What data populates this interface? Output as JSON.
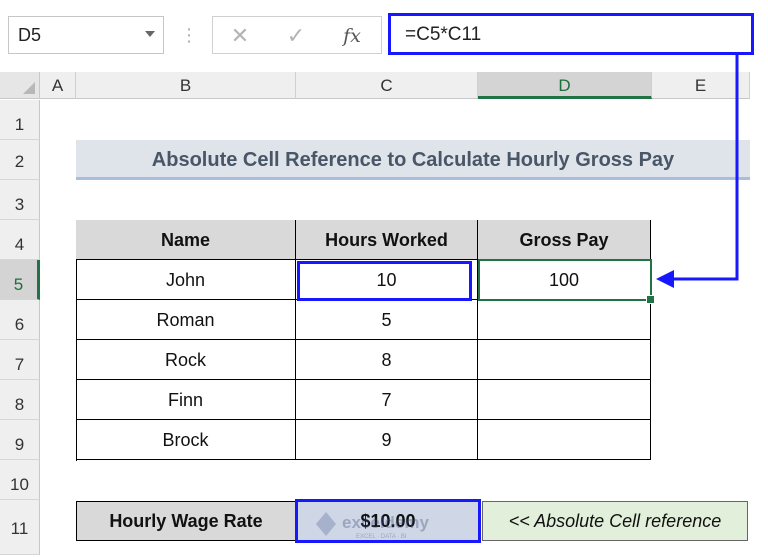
{
  "formula_bar": {
    "name_box": "D5",
    "cancel_icon": "✕",
    "enter_icon": "✓",
    "fx_label": "fx",
    "formula": "=C5*C11"
  },
  "columns": [
    "A",
    "B",
    "C",
    "D",
    "E"
  ],
  "selected_column": "D",
  "rows": [
    "1",
    "2",
    "3",
    "4",
    "5",
    "6",
    "7",
    "8",
    "9",
    "10",
    "11"
  ],
  "selected_row": "5",
  "sheet": {
    "title": "Absolute Cell Reference to Calculate Hourly Gross Pay",
    "table": {
      "headers": [
        "Name",
        "Hours Worked",
        "Gross Pay"
      ],
      "rows": [
        [
          "John",
          "10",
          "100"
        ],
        [
          "Roman",
          "5",
          ""
        ],
        [
          "Rock",
          "8",
          ""
        ],
        [
          "Finn",
          "7",
          ""
        ],
        [
          "Brock",
          "9",
          ""
        ]
      ]
    },
    "rate_label": "Hourly Wage Rate",
    "rate_value": "$10.00",
    "note": "<< Absolute Cell reference"
  },
  "watermark": {
    "name": "exceldemy",
    "tagline": "EXCEL · DATA · BI"
  },
  "colors": {
    "annotation_blue": "#1818ff",
    "selection_green": "#217346",
    "title_fill": "#dfe3ea",
    "header_fill": "#d9d9d9",
    "note_fill": "#e2efda"
  }
}
